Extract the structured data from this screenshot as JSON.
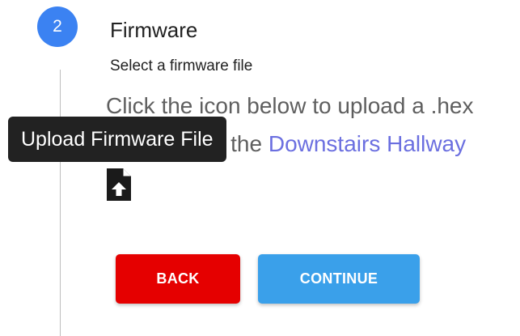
{
  "step": {
    "number": "2",
    "title": "Firmware",
    "subtitle": "Select a firmware file"
  },
  "description": {
    "line1": "Click the icon below to upload a .hex",
    "line2_prefix": "uploaded to the ",
    "device_name": "Downstairs Hallway"
  },
  "tooltip": {
    "text": "Upload Firmware File"
  },
  "upload_icon": {
    "icon": "file-upload-icon"
  },
  "buttons": {
    "back_label": "BACK",
    "continue_label": "CONTINUE"
  },
  "colors": {
    "step_circle": "#3b82f2",
    "back_button": "#e50000",
    "continue_button": "#3aa0ea",
    "link": "#6b6fe0",
    "tooltip_bg": "#222222"
  }
}
